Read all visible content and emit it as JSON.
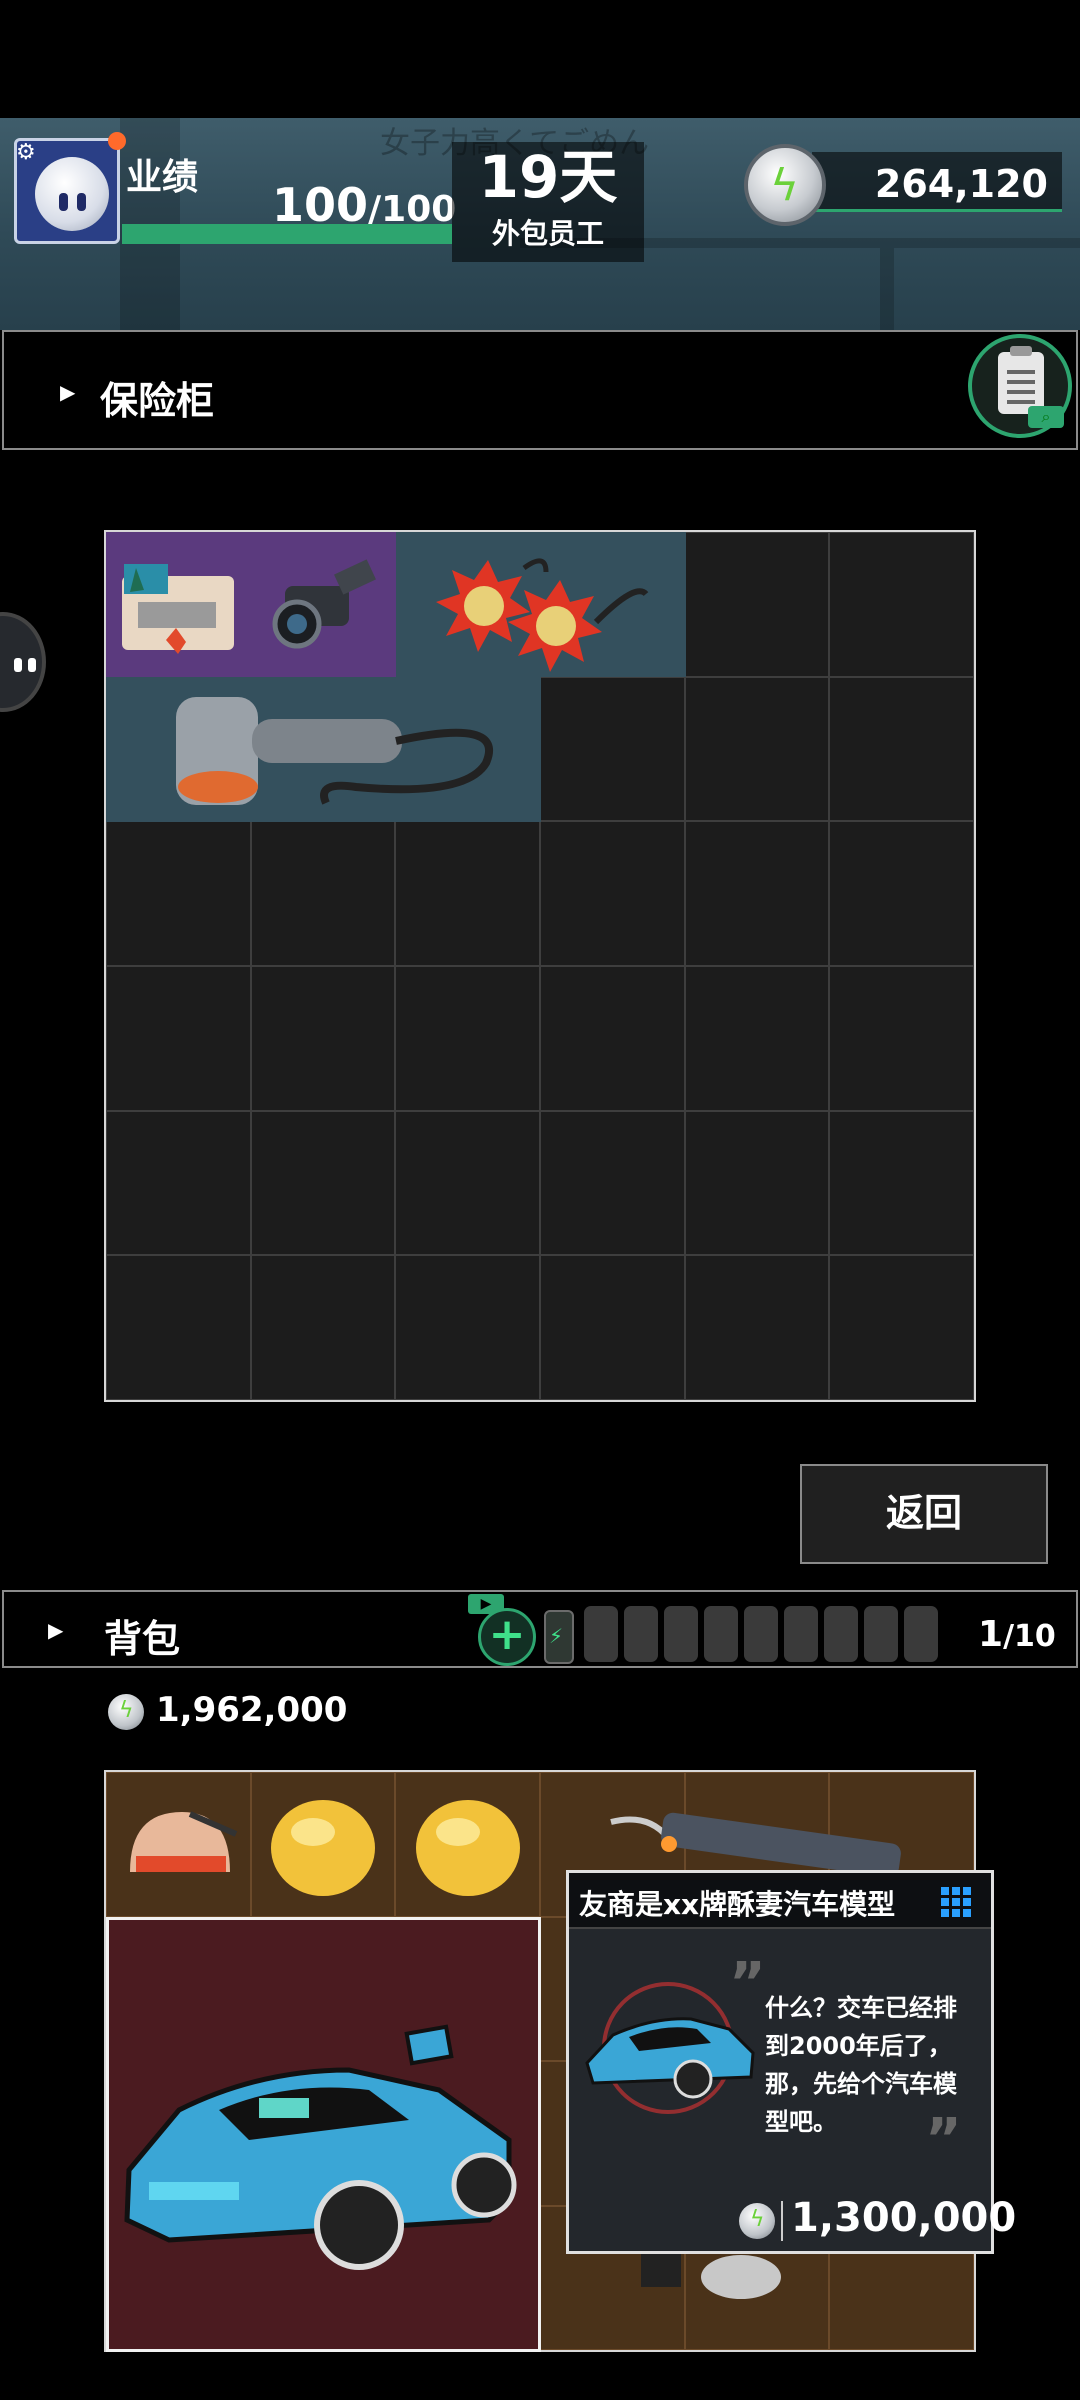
{
  "hud": {
    "watermark": "女子力高くてごめん",
    "performance_label": "业绩",
    "performance_current": "100",
    "performance_max": "/100",
    "performance_fill": 1.0,
    "day_count": "19天",
    "role": "外包员工",
    "currency": "264,120",
    "icons": [
      "settings-icon",
      "lightning-coin-icon"
    ]
  },
  "safe": {
    "title": "保险柜",
    "columns": 6,
    "rows": 6,
    "items": [
      {
        "name": "postcard",
        "color": "#5b3a7e"
      },
      {
        "name": "camera-scope",
        "color": "#5b3a7e"
      },
      {
        "name": "spiked-flails",
        "color": "#34505d"
      },
      {
        "name": "hair-dryer",
        "color": "#34505d"
      }
    ]
  },
  "return_button": "返回",
  "backpack": {
    "title": "背包",
    "slots_used": "1",
    "slots_max": "/10",
    "total_value": "1,962,000",
    "columns": 6,
    "rows": 4
  },
  "tooltip": {
    "title": "友商是xx牌酥妻汽车模型",
    "description": "什么？交车已经排到2000年后了，那，先给个汽车模型吧。",
    "price": "1,300,000"
  },
  "colors": {
    "accent": "#2da56f",
    "rare_purple": "#5b3a7e",
    "item_blue": "#34505d",
    "selected_red": "#4b1b20",
    "bag_brown": "#4a3219"
  }
}
